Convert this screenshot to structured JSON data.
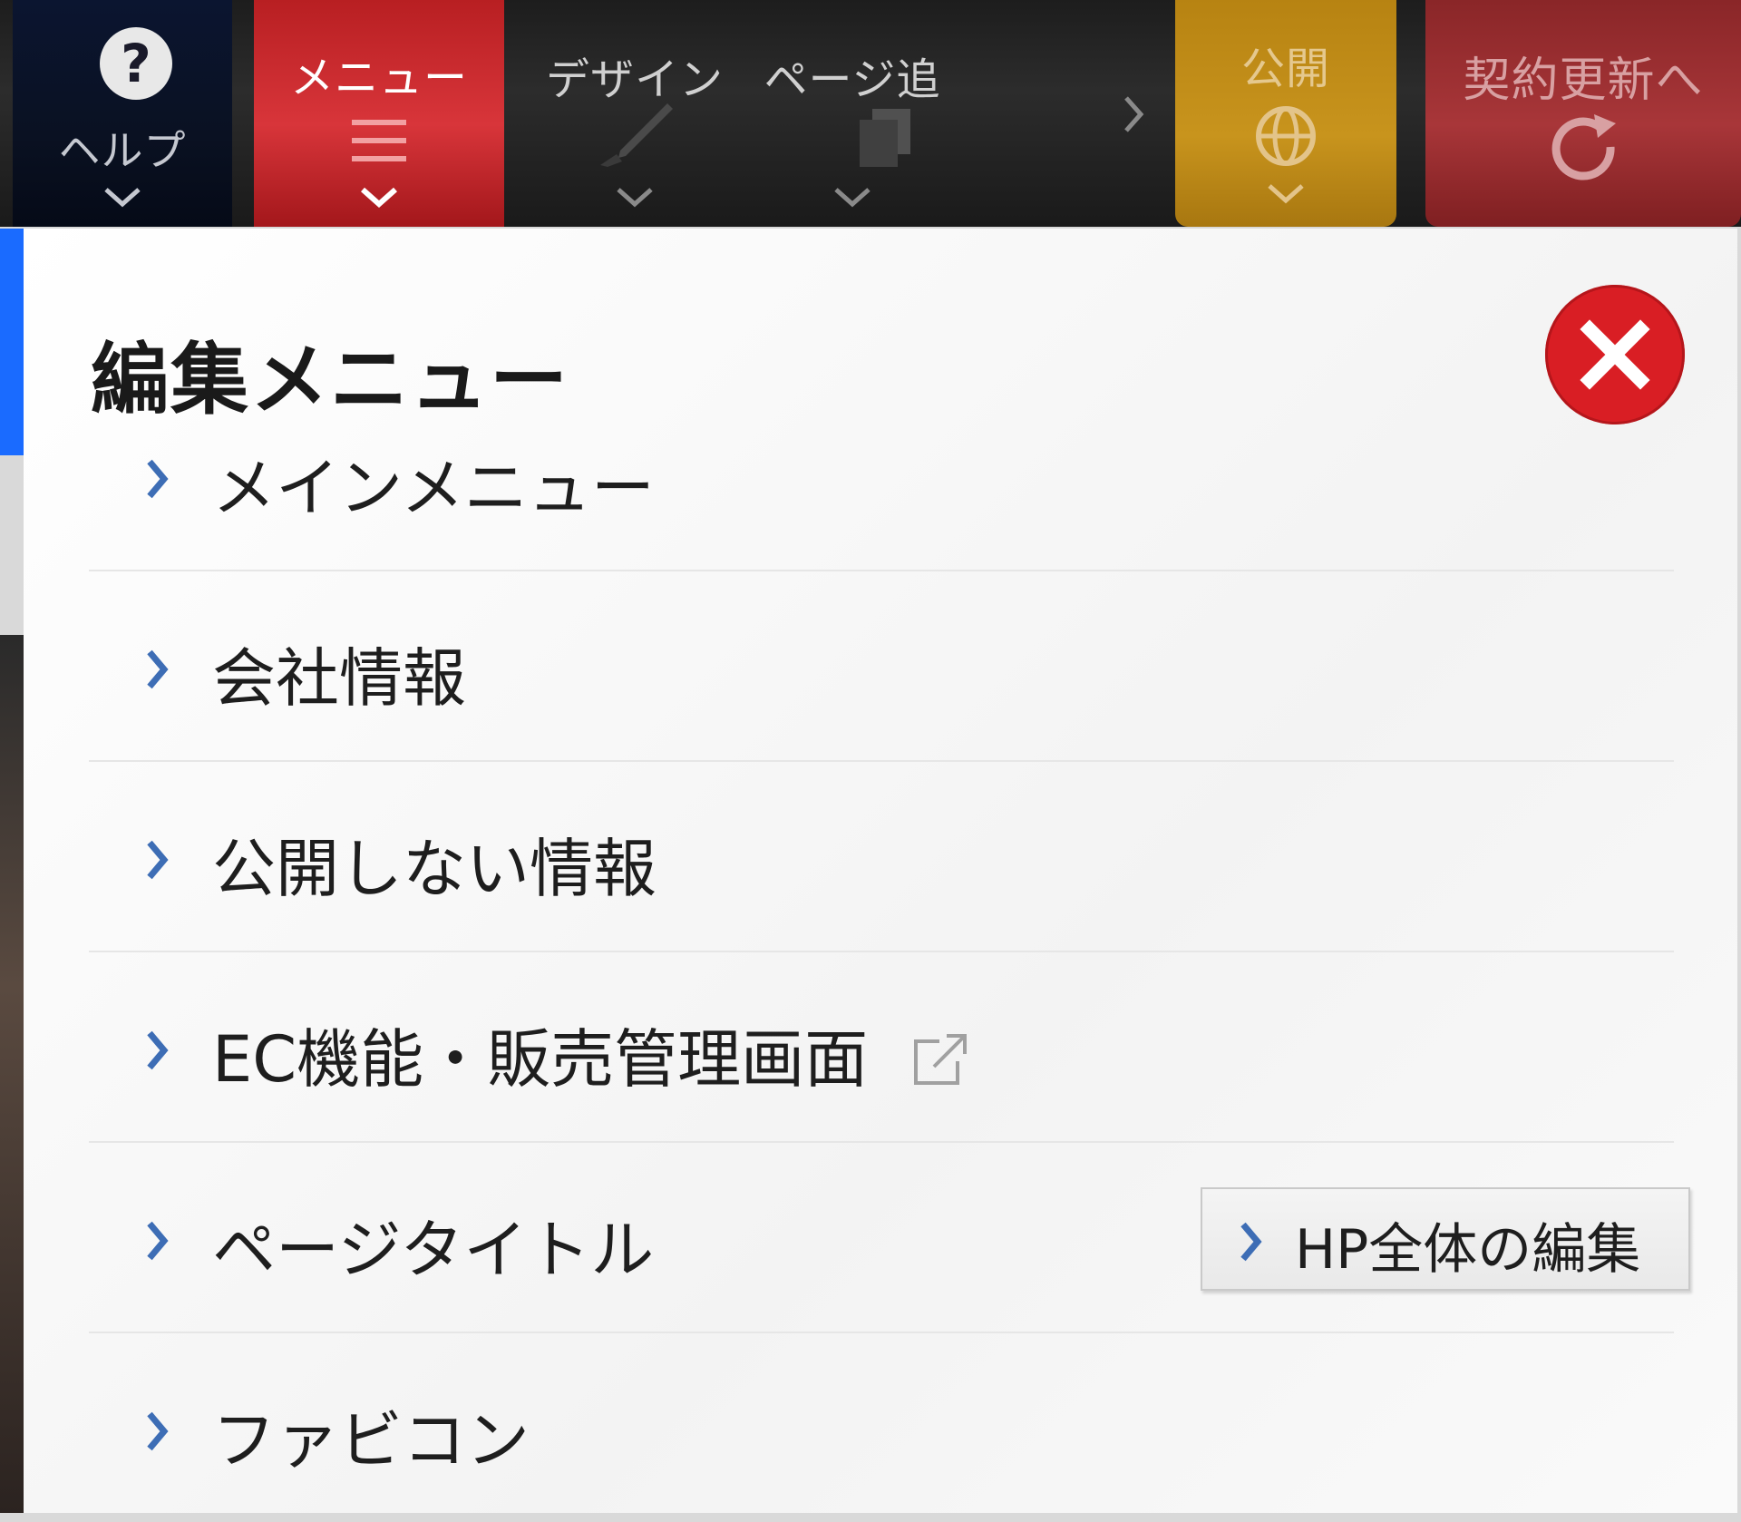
{
  "toolbar": {
    "help": {
      "label": "ヘルプ",
      "icon": "question-circle-icon"
    },
    "menu": {
      "label": "メニュー",
      "icon": "hamburger-icon"
    },
    "design": {
      "label": "デザイン",
      "icon": "brush-icon"
    },
    "page_add": {
      "label": "ページ追",
      "icon": "pages-icon"
    },
    "publish": {
      "label": "公開",
      "icon": "globe-icon"
    },
    "renew": {
      "label": "契約更新へ",
      "icon": "refresh-icon"
    }
  },
  "panel": {
    "title": "編集メニュー",
    "items": [
      {
        "label": "メインメニュー"
      },
      {
        "label": "会社情報"
      },
      {
        "label": "公開しない情報"
      },
      {
        "label": "EC機能・販売管理画面",
        "external": true
      },
      {
        "label": "ページタイトル"
      },
      {
        "label": "ファビコン"
      }
    ],
    "hp_edit_button": "HP全体の編集"
  },
  "colors": {
    "active_menu": "#d8353a",
    "publish": "#c8941d",
    "renew": "#a83639",
    "close": "#d91e24",
    "chevron": "#3d6db5"
  }
}
